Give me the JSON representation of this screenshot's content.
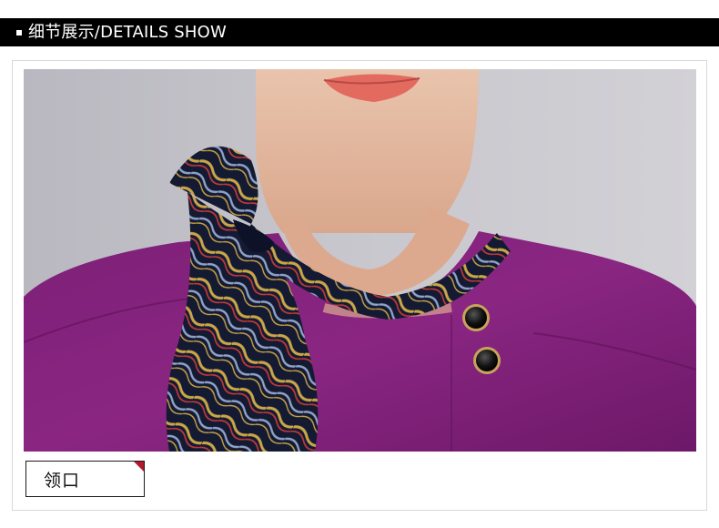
{
  "header": {
    "title": "细节展示/DETAILS SHOW"
  },
  "photo": {
    "description_icon": "uniform-collar-detail-photo"
  },
  "label": {
    "text": "领口"
  },
  "colors": {
    "header_bg": "#000000",
    "tag_corner": "#b3192d",
    "uniform_purple": "#7a1e74",
    "background": "#ffffff"
  }
}
